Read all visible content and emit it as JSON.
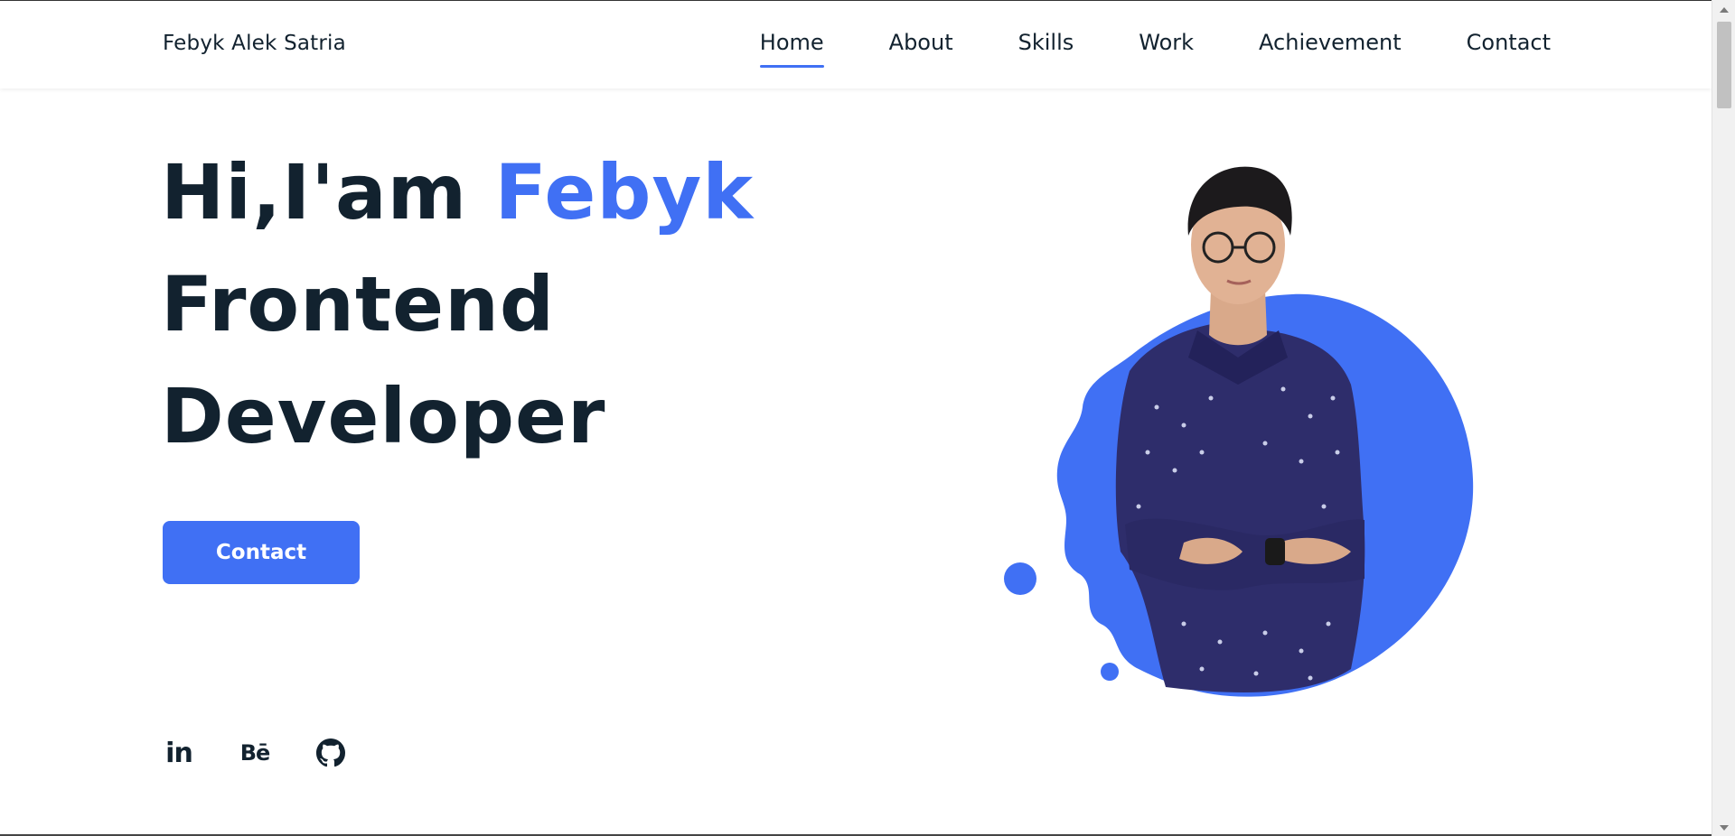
{
  "header": {
    "brand": "Febyk Alek Satria",
    "nav": [
      {
        "label": "Home",
        "active": true
      },
      {
        "label": "About",
        "active": false
      },
      {
        "label": "Skills",
        "active": false
      },
      {
        "label": "Work",
        "active": false
      },
      {
        "label": "Achievement",
        "active": false
      },
      {
        "label": "Contact",
        "active": false
      }
    ]
  },
  "hero": {
    "greeting": "Hi,I'am",
    "name": "Febyk",
    "line2": "Frontend",
    "line3": "Developer",
    "cta_label": "Contact"
  },
  "social": [
    {
      "icon": "linkedin-icon",
      "glyph": "in"
    },
    {
      "icon": "behance-icon",
      "glyph": "Bē"
    },
    {
      "icon": "github-icon",
      "glyph": ""
    }
  ],
  "colors": {
    "accent": "#4070f4",
    "text": "#12222f",
    "background": "#ffffff"
  }
}
